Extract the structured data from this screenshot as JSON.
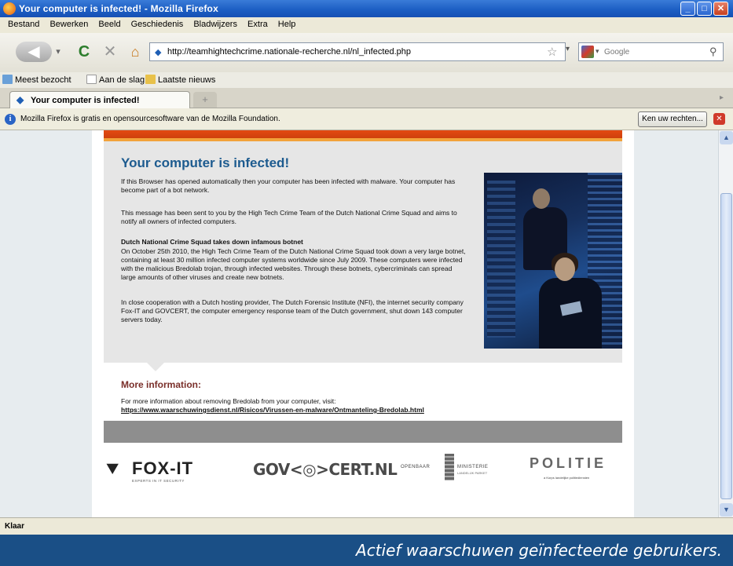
{
  "window": {
    "title": "Your computer is infected! - Mozilla Firefox",
    "minimize": "_",
    "maximize": "□",
    "close": "✕"
  },
  "menu": [
    "Bestand",
    "Bewerken",
    "Beeld",
    "Geschiedenis",
    "Bladwijzers",
    "Extra",
    "Help"
  ],
  "nav": {
    "back_glyph": "◀",
    "history_glyph": "▾",
    "reload_glyph": "C",
    "stop_glyph": "✕",
    "home_glyph": "⌂",
    "url": "http://teamhightechcrime.nationale-recherche.nl/nl_infected.php",
    "url_favicon": "◆",
    "star_glyph": "☆",
    "url_dropdown_glyph": "▾",
    "search_placeholder": "Google",
    "search_engine_arrow": "▾",
    "search_go_glyph": "⚲"
  },
  "bookmarks": [
    "Meest bezocht",
    "Aan de slag",
    "Laatste nieuws"
  ],
  "tabs": {
    "active_label": "Your computer is infected!",
    "active_icon": "◆",
    "new_tab_glyph": "+",
    "scroll_glyph": "▸"
  },
  "notification": {
    "info_glyph": "i",
    "message": "Mozilla Firefox is gratis en opensourcesoftware van de Mozilla Foundation.",
    "button_label": "Ken uw rechten...",
    "close_glyph": "✕"
  },
  "article": {
    "heading": "Your computer is infected!",
    "p1": "If this Browser has opened automatically then your computer has been infected with malware. Your computer has become part of a bot network.",
    "p2": "This message has been sent to you by the High Tech Crime Team of the Dutch National Crime Squad and aims to notify all owners of infected computers.",
    "subheading": "Dutch National Crime Squad takes down infamous botnet",
    "p3": "On October 25th 2010, the High Tech Crime Team of the Dutch National Crime Squad took down a very large botnet, containing at least 30 million infected computer systems worldwide since July 2009. These computers were infected with the malicious Bredolab trojan, through infected websites. Through these botnets, cybercriminals can spread large amounts of other viruses and create new botnets.",
    "p4": "In close cooperation with a Dutch hosting provider, The Dutch Forensic Institute (NFI), the internet security company Fox-IT and GOVCERT, the computer emergency response team of the Dutch government, shut down 143 computer servers today.",
    "more_heading": "More information:",
    "more_text": "For more information about removing Bredolab from your computer, visit:",
    "more_link": "https://www.waarschuwingsdienst.nl/Risicos/Virussen-en-malware/Ontmanteling-Bredolab.html"
  },
  "logos": {
    "foxit_mark": "⯆",
    "foxit_name": "FOX-IT",
    "foxit_tag": "EXPERTS IN IT SECURITY",
    "govcert": "GOV<◎>CERT.NL",
    "om_left": "OPENBAAR",
    "om_right": "MINISTERIE",
    "om_sub": "LANDELIJK PARKET",
    "politie": "POLITIE",
    "politie_tag": "a Korps landelijke politiediensten"
  },
  "scrollbar": {
    "up_glyph": "▲",
    "down_glyph": "▼",
    "position": 0.16
  },
  "status": "Klaar",
  "caption": "Actief waarschuwen geïnfecteerde gebruikers."
}
